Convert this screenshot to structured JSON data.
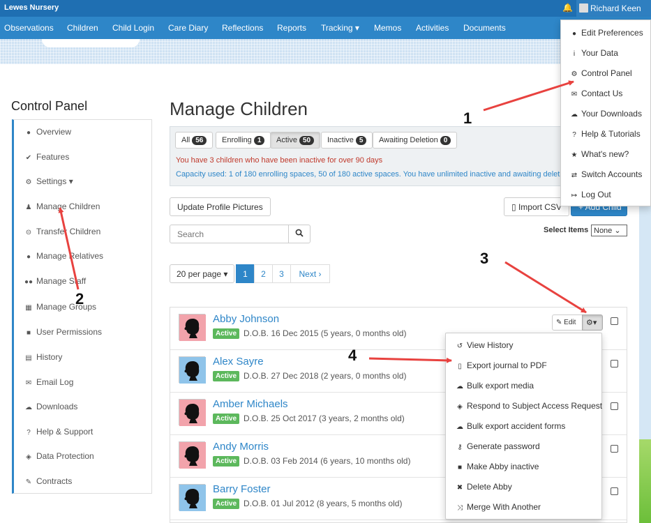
{
  "app": {
    "name": "Lewes Nursery",
    "user_name": "Richard Keen"
  },
  "nav": [
    "Observations",
    "Children",
    "Child Login",
    "Care Diary",
    "Reflections",
    "Reports",
    "Tracking",
    "Memos",
    "Activities",
    "Documents"
  ],
  "user_menu": [
    "Edit Preferences",
    "Your Data",
    "Control Panel",
    "Contact Us",
    "Your Downloads",
    "Help & Tutorials",
    "What's new?",
    "Switch Accounts",
    "Log Out"
  ],
  "sidebar": {
    "title": "Control Panel",
    "items": [
      "Overview",
      "Features",
      "Settings",
      "Manage Children",
      "Transfer Children",
      "Manage Relatives",
      "Manage Staff",
      "Manage Groups",
      "User Permissions",
      "History",
      "Email Log",
      "Downloads",
      "Help & Support",
      "Data Protection",
      "Contracts"
    ]
  },
  "main": {
    "title": "Manage Children",
    "filters": [
      {
        "label": "All",
        "count": "56"
      },
      {
        "label": "Enrolling",
        "count": "1"
      },
      {
        "label": "Active",
        "count": "50"
      },
      {
        "label": "Inactive",
        "count": "5"
      },
      {
        "label": "Awaiting Deletion",
        "count": "0"
      }
    ],
    "warning": "You have 3 children who have been inactive for over 90 days",
    "capacity": "Capacity used: 1 of 180 enrolling spaces, 50 of 180 active spaces. You have unlimited inactive and awaiting deletion spaces.",
    "update_pictures": "Update Profile Pictures",
    "import_csv": "Import CSV",
    "add_child": "+ Add Child",
    "search_placeholder": "Search",
    "select_items_label": "Select Items",
    "select_items_value": "None",
    "per_page": "20 per page",
    "pages": [
      "1",
      "2",
      "3"
    ],
    "next": "Next"
  },
  "children": [
    {
      "name": "Abby Johnson",
      "status": "Active",
      "dob": "D.O.B. 16 Dec 2015 (5 years, 0 months old)",
      "gender": "girl"
    },
    {
      "name": "Alex Sayre",
      "status": "Active",
      "dob": "D.O.B. 27 Dec 2018 (2 years, 0 months old)",
      "gender": "boy"
    },
    {
      "name": "Amber Michaels",
      "status": "Active",
      "dob": "D.O.B. 25 Oct 2017 (3 years, 2 months old)",
      "gender": "girl"
    },
    {
      "name": "Andy Morris",
      "status": "Active",
      "dob": "D.O.B. 03 Feb 2014 (6 years, 10 months old)",
      "gender": "girl"
    },
    {
      "name": "Barry Foster",
      "status": "Active",
      "dob": "D.O.B. 01 Jul 2012 (8 years, 5 months old)",
      "gender": "boy"
    }
  ],
  "row_actions": {
    "edit": "Edit"
  },
  "child_menu": [
    "View History",
    "Export journal to PDF",
    "Bulk export media",
    "Respond to Subject Access Request",
    "Bulk export accident forms",
    "Generate password",
    "Make Abby inactive",
    "Delete Abby",
    "Merge With Another"
  ],
  "annotations": [
    "1",
    "2",
    "3",
    "4"
  ],
  "colors": {
    "brand": "#2e86c8",
    "active_badge": "#5cb85c",
    "warning": "#c0392b",
    "arrow": "#e8423f",
    "girl_bg": "#f2a3ab",
    "boy_bg": "#8fc4ea"
  }
}
